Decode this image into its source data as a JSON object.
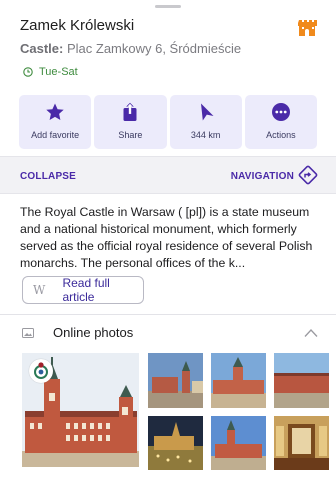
{
  "place": {
    "title": "Zamek Królewski",
    "category": "Castle:",
    "address": " Plac Zamkowy 6, Śródmieście",
    "hours": "Tue-Sat"
  },
  "actions": [
    {
      "label": "Add favorite",
      "icon": "star-icon"
    },
    {
      "label": "Share",
      "icon": "share-icon"
    },
    {
      "label": "344 km",
      "icon": "direction-arrow-icon"
    },
    {
      "label": "Actions",
      "icon": "more-icon"
    }
  ],
  "bar": {
    "collapse": "COLLAPSE",
    "navigation": "NAVIGATION"
  },
  "description": "The Royal Castle in Warsaw ( [pl]) is a state museum and a national historical monument, which formerly served as the official royal residence of several Polish monarchs. The personal offices of the k...",
  "read_article": {
    "icon_letter": "W",
    "label": "Read full article"
  },
  "photos": {
    "title": "Online photos",
    "items": [
      "castle-photo-large",
      "castle-photo-1",
      "castle-photo-2",
      "castle-photo-3",
      "castle-photo-4",
      "castle-photo-5",
      "castle-photo-6"
    ]
  },
  "colors": {
    "accent": "#4a2aa8",
    "action_bg": "#ecebfb",
    "open_hours_green": "#3e8b3e",
    "castle_orange": "#f08a1c"
  }
}
